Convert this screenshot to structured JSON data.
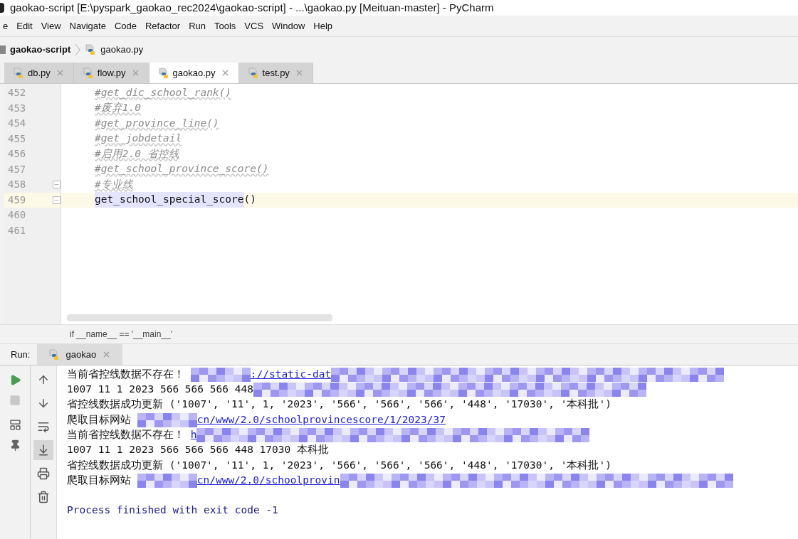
{
  "window": {
    "title": "gaokao-script [E:\\pyspark_gaokao_rec2024\\gaokao-script] - ...\\gaokao.py [Meituan-master] - PyCharm"
  },
  "menu": [
    "e",
    "Edit",
    "View",
    "Navigate",
    "Code",
    "Refactor",
    "Run",
    "Tools",
    "VCS",
    "Window",
    "Help"
  ],
  "breadcrumb": {
    "project": "gaokao-script",
    "file": "gaokao.py"
  },
  "tabs": [
    {
      "label": "db.py",
      "selected": false
    },
    {
      "label": "flow.py",
      "selected": false
    },
    {
      "label": "gaokao.py",
      "selected": true
    },
    {
      "label": "test.py",
      "selected": false
    }
  ],
  "editor": {
    "lines": [
      {
        "number": "452",
        "current": false,
        "fold": false,
        "parts": [
          {
            "text": "#get_dic_school_rank()",
            "kind": "comment"
          }
        ]
      },
      {
        "number": "453",
        "current": false,
        "fold": false,
        "parts": [
          {
            "text": "#废弃1.0",
            "kind": "comment"
          }
        ]
      },
      {
        "number": "454",
        "current": false,
        "fold": false,
        "parts": [
          {
            "text": "#get_province_line()",
            "kind": "comment"
          }
        ]
      },
      {
        "number": "455",
        "current": false,
        "fold": false,
        "parts": [
          {
            "text": "#get_jobdetail",
            "kind": "comment"
          }
        ]
      },
      {
        "number": "456",
        "current": false,
        "fold": false,
        "parts": [
          {
            "text": "#启用2.0 省控线",
            "kind": "comment"
          }
        ]
      },
      {
        "number": "457",
        "current": false,
        "fold": false,
        "parts": [
          {
            "text": "#get_school_province_score()",
            "kind": "comment"
          }
        ]
      },
      {
        "number": "458",
        "current": false,
        "fold": true,
        "parts": [
          {
            "text": "#专业线",
            "kind": "comment"
          }
        ]
      },
      {
        "number": "459",
        "current": true,
        "fold": true,
        "parts": [
          {
            "text": "get_school_special_score",
            "kind": "selected"
          },
          {
            "text": "()",
            "kind": "code"
          }
        ]
      },
      {
        "number": "460",
        "current": false,
        "fold": false
      },
      {
        "number": "461",
        "current": false,
        "fold": false
      }
    ],
    "context": "if __name__ == '__main__'"
  },
  "run": {
    "label": "Run:",
    "tab": "gaokao"
  },
  "console": {
    "lines": [
      {
        "parts": [
          {
            "text": "当前省控线数据不存在！ ",
            "kind": "plain"
          },
          {
            "kind": "redaction"
          },
          {
            "text": "://static-dat",
            "kind": "link"
          },
          {
            "kind": "redaction"
          }
        ]
      },
      {
        "parts": [
          {
            "text": "1007 11 1 2023 566 566 566 448",
            "kind": "plain"
          },
          {
            "kind": "redaction"
          }
        ]
      },
      {
        "parts": [
          {
            "text": "省控线数据成功更新 ('1007', '11', 1, '2023', '566', '566', '566', '448', '17030', '本科批')",
            "kind": "plain"
          }
        ]
      },
      {
        "parts": [
          {
            "text": "爬取目标网站 ",
            "kind": "plain"
          },
          {
            "kind": "redaction"
          },
          {
            "text": "cn/www/2.0/schoolprovincescore/1/2023/37",
            "kind": "link"
          }
        ]
      },
      {
        "parts": [
          {
            "text": "当前省控线数据不存在！ ",
            "kind": "plain"
          },
          {
            "text": "h",
            "kind": "link"
          },
          {
            "kind": "redaction"
          }
        ]
      },
      {
        "parts": [
          {
            "text": "1007 11 1 2023 566 566 566 448 17030 本科批",
            "kind": "plain"
          }
        ]
      },
      {
        "parts": [
          {
            "text": "省控线数据成功更新 ('1007', '11', 1, '2023', '566', '566', '566', '448', '17030', '本科批')",
            "kind": "plain"
          }
        ]
      },
      {
        "parts": [
          {
            "text": "爬取目标网站 ",
            "kind": "plain"
          },
          {
            "kind": "redaction"
          },
          {
            "text": "cn/www/2.0/schoolprovin",
            "kind": "link"
          },
          {
            "kind": "redaction"
          }
        ]
      },
      {
        "parts": [
          {
            "text": "Process finished with exit code -1",
            "kind": "exit"
          }
        ]
      }
    ]
  },
  "run_tools": [
    {
      "kind": "up",
      "selected": false
    },
    {
      "kind": "down",
      "selected": false
    },
    {
      "kind": "wrap",
      "selected": false
    },
    {
      "kind": "scroll-end",
      "selected": true
    },
    {
      "kind": "print",
      "selected": false
    },
    {
      "kind": "trash",
      "selected": false
    }
  ]
}
